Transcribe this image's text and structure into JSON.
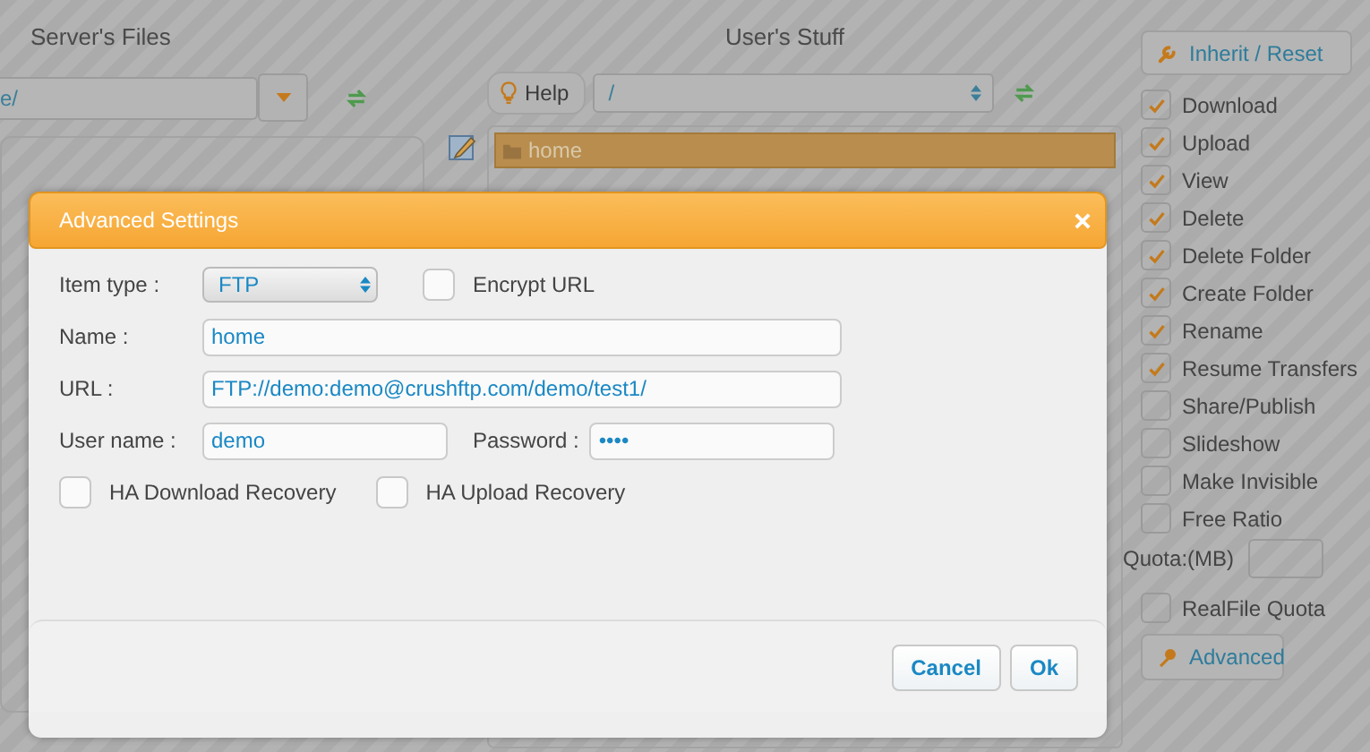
{
  "left_pane": {
    "title": "Server's Files",
    "path": "e/"
  },
  "right_pane": {
    "title": "User's Stuff",
    "help_button": "Help",
    "path": "/",
    "items": [
      {
        "name": "home",
        "selected": true
      }
    ]
  },
  "permissions": {
    "reset_button": "Inherit / Reset",
    "options": [
      {
        "label": "Download",
        "checked": true
      },
      {
        "label": "Upload",
        "checked": true
      },
      {
        "label": "View",
        "checked": true
      },
      {
        "label": "Delete",
        "checked": true
      },
      {
        "label": "Delete Folder",
        "checked": true
      },
      {
        "label": "Create Folder",
        "checked": true
      },
      {
        "label": "Rename",
        "checked": true
      },
      {
        "label": "Resume Transfers",
        "checked": true
      },
      {
        "label": "Share/Publish",
        "checked": false
      },
      {
        "label": "Slideshow",
        "checked": false
      },
      {
        "label": "Make Invisible",
        "checked": false
      },
      {
        "label": "Free Ratio",
        "checked": false
      }
    ],
    "quota_label": "Quota:(MB)",
    "realfile_quota": {
      "label": "RealFile Quota",
      "checked": false
    },
    "advanced_button": "Advanced"
  },
  "dialog": {
    "title": "Advanced Settings",
    "item_type_label": "Item type :",
    "item_type": "FTP",
    "encrypt_url": {
      "label": "Encrypt URL",
      "checked": false
    },
    "name_label": "Name :",
    "name": "home",
    "url_label": "URL :",
    "url": "FTP://demo:demo@crushftp.com/demo/test1/",
    "username_label": "User name :",
    "username": "demo",
    "password_label": "Password :",
    "password": "••••",
    "ha_download": {
      "label": "HA Download Recovery",
      "checked": false
    },
    "ha_upload": {
      "label": "HA Upload Recovery",
      "checked": false
    },
    "buttons": [
      "Cancel",
      "Ok"
    ]
  }
}
